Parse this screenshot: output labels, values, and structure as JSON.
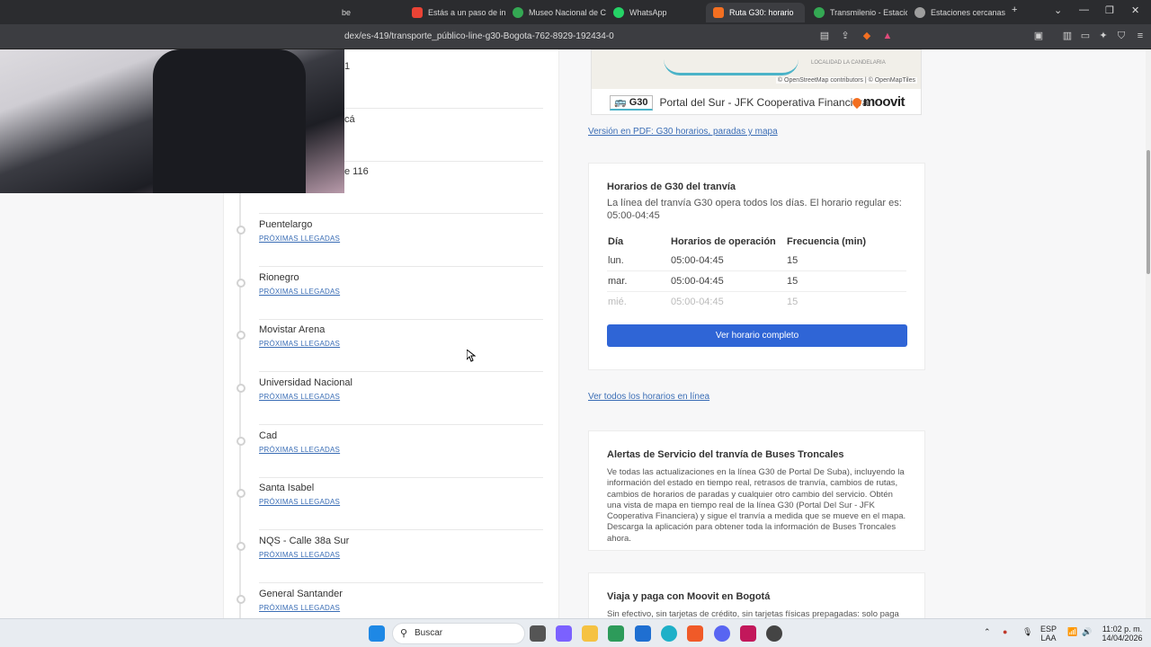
{
  "browser": {
    "tabs": [
      {
        "label": "be",
        "favicon_color": "#ff0000"
      },
      {
        "label": "Estás a un paso de in",
        "favicon_color": "#ea4335"
      },
      {
        "label": "Museo Nacional de C",
        "favicon_color": "#34a853"
      },
      {
        "label": "WhatsApp",
        "favicon_color": "#25d366"
      },
      {
        "label": "Ruta G30: horario",
        "favicon_color": "#f36f21",
        "active": true
      },
      {
        "label": "Transmilenio - Estació",
        "favicon_color": "#34a853"
      },
      {
        "label": "Estaciones cercanas B",
        "favicon_color": "#9e9e9e"
      }
    ],
    "new_tab": "+",
    "url": "dex/es-419/transporte_público-line-g30-Bogota-762-8929-192434-0"
  },
  "left": {
    "partial_stops": [
      {
        "name": "1"
      },
      {
        "name": "cá"
      },
      {
        "name": "e 116"
      }
    ],
    "stops": [
      {
        "name": "Puentelargo",
        "link": "PRÓXIMAS LLEGADAS"
      },
      {
        "name": "Rionegro",
        "link": "PRÓXIMAS LLEGADAS"
      },
      {
        "name": "Movistar Arena",
        "link": "PRÓXIMAS LLEGADAS"
      },
      {
        "name": "Universidad Nacional",
        "link": "PRÓXIMAS LLEGADAS"
      },
      {
        "name": "Cad",
        "link": "PRÓXIMAS LLEGADAS"
      },
      {
        "name": "Santa Isabel",
        "link": "PRÓXIMAS LLEGADAS"
      },
      {
        "name": "NQS - Calle 38a Sur",
        "link": "PRÓXIMAS LLEGADAS"
      },
      {
        "name": "General Santander",
        "link": "PRÓXIMAS LLEGADAS"
      }
    ]
  },
  "map": {
    "area_label": "LOCALIDAD LA CANDELARIA",
    "attribution": "© OpenStreetMap contributors | © OpenMapTiles",
    "line_badge": "G30",
    "route": "Portal del Sur - JFK Cooperativa Financiera",
    "brand": "moovit"
  },
  "pdf_link": "Versión en PDF: G30 horarios, paradas y mapa",
  "schedule": {
    "title": "Horarios de G30 del tranvía",
    "description": "La línea del tranvía G30 opera todos los días. El horario regular es: 05:00-04:45",
    "headers": [
      "Día",
      "Horarios de operación",
      "Frecuencia (min)"
    ],
    "rows": [
      [
        "lun.",
        "05:00-04:45",
        "15"
      ],
      [
        "mar.",
        "05:00-04:45",
        "15"
      ],
      [
        "mié.",
        "05:00-04:45",
        "15"
      ]
    ],
    "button": "Ver horario completo"
  },
  "all_schedules_link": "Ver todos los horarios en línea",
  "alerts": {
    "title": "Alertas de Servicio del tranvía de Buses Troncales",
    "body": "Ve todas las actualizaciones en la línea G30 de Portal De Suba), incluyendo la información del estado en tiempo real, retrasos de tranvía, cambios de rutas, cambios de horarios de paradas y cualquier otro cambio del servicio. Obtén una vista de mapa en tiempo real de la línea G30 (Portal Del Sur - JFK Cooperativa Financiera) y sigue el tranvía a medida que se mueve en el mapa. Descarga la aplicación para obtener toda la información de Buses Troncales ahora."
  },
  "pay": {
    "title": "Viaja y paga con Moovit en Bogotá",
    "body": "Sin efectivo, sin tarjetas de crédito, sin tarjetas físicas prepagadas: solo paga"
  },
  "taskbar": {
    "search_placeholder": "Buscar",
    "lang": "ESP",
    "lang2": "LAA",
    "time": "11:02 p. m.",
    "date": "14/04/2026"
  }
}
